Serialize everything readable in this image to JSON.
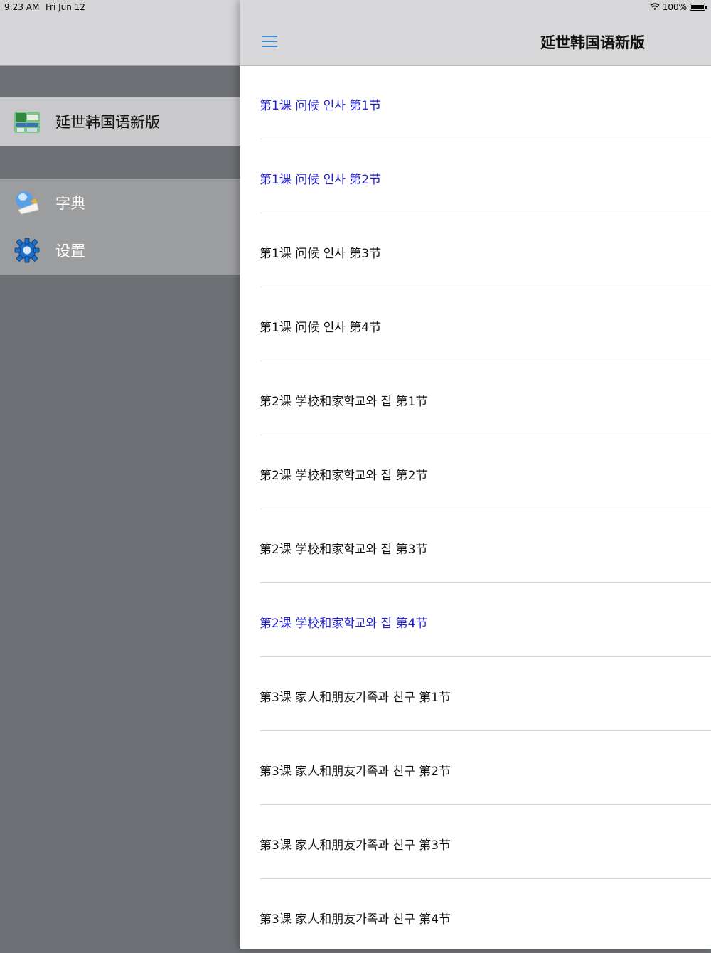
{
  "status_bar": {
    "time": "9:23 AM",
    "date": "Fri Jun 12",
    "battery": "100%",
    "battery_level": 1.0
  },
  "sidebar": {
    "app_item": {
      "label": "延世韩国语新版",
      "icon": "app-logo-icon"
    },
    "items": [
      {
        "label": "字典",
        "icon": "dictionary-icon"
      },
      {
        "label": "设置",
        "icon": "gear-icon"
      }
    ]
  },
  "main": {
    "title": "延世韩国语新版",
    "menu_icon": "hamburger-menu-icon",
    "lessons": [
      {
        "label": "第1课 问候 인사 第1节",
        "visited": true
      },
      {
        "label": "第1课 问候 인사 第2节",
        "visited": true
      },
      {
        "label": "第1课 问候 인사 第3节",
        "visited": false
      },
      {
        "label": "第1课 问候 인사 第4节",
        "visited": false
      },
      {
        "label": "第2课 学校和家학교와 집 第1节",
        "visited": false
      },
      {
        "label": "第2课 学校和家학교와 집 第2节",
        "visited": false
      },
      {
        "label": "第2课 学校和家학교와 집 第3节",
        "visited": false
      },
      {
        "label": "第2课 学校和家학교와 집 第4节",
        "visited": true
      },
      {
        "label": "第3课 家人和朋友가족과 친구 第1节",
        "visited": false
      },
      {
        "label": "第3课 家人和朋友가족과 친구 第2节",
        "visited": false
      },
      {
        "label": "第3课 家人和朋友가족과 친구 第3节",
        "visited": false
      },
      {
        "label": "第3课 家人和朋友가족과 친구 第4节",
        "visited": false
      }
    ]
  },
  "colors": {
    "visited_link": "#2222cc",
    "accent": "#3a8ad8"
  }
}
